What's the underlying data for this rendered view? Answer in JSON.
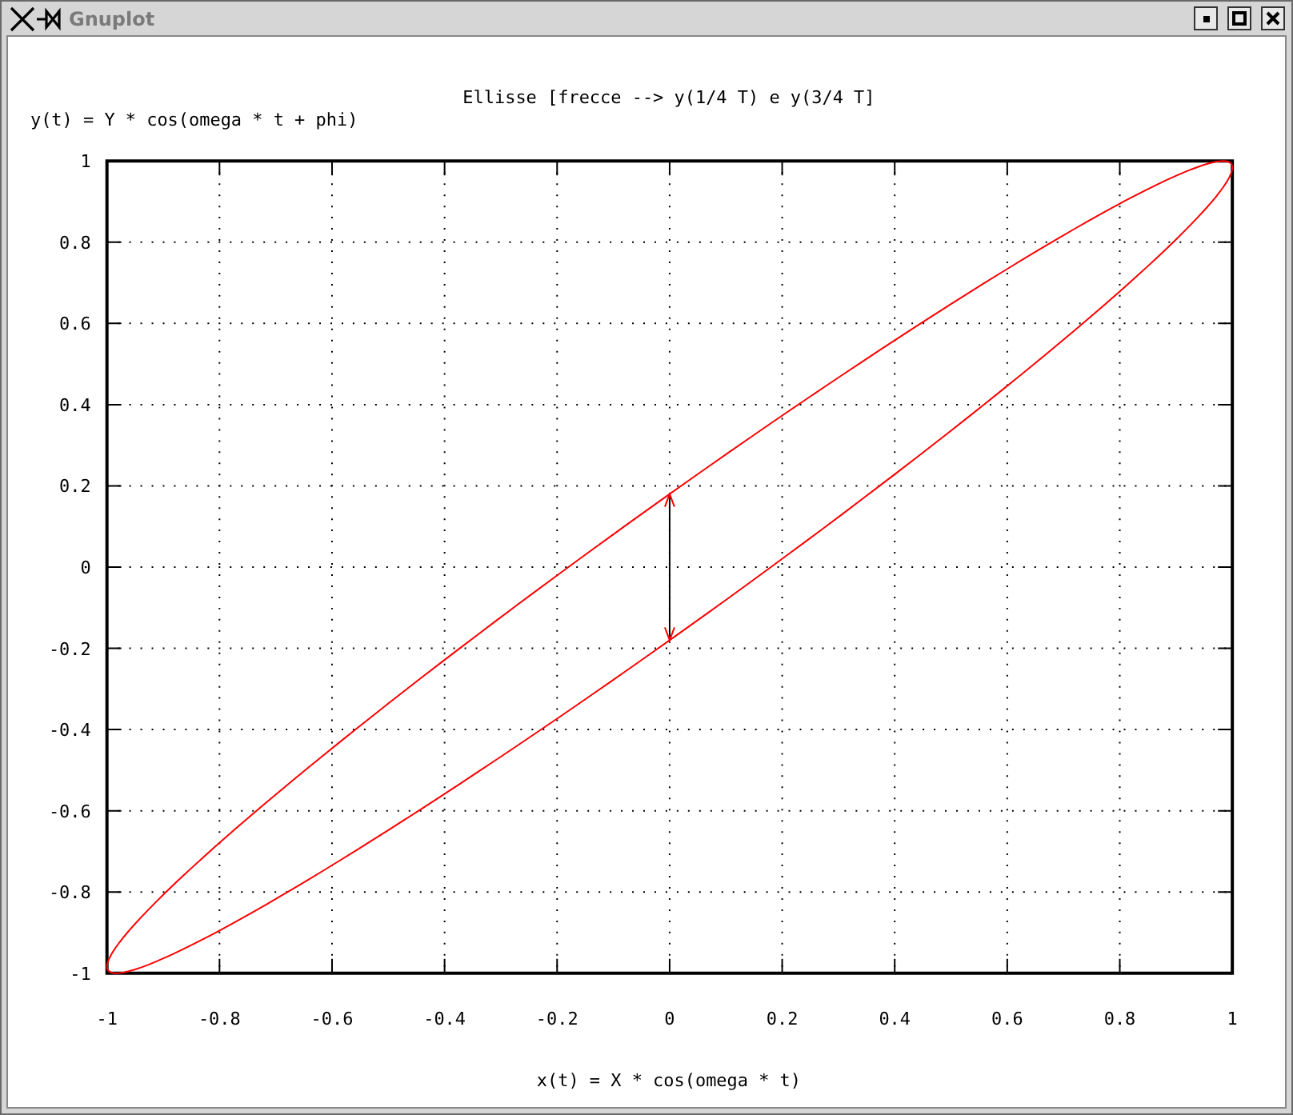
{
  "window": {
    "title": "Gnuplot"
  },
  "plot": {
    "chart_data": {
      "type": "line",
      "title": "Ellisse [frecce --> y(1/4 T) e y(3/4 T]",
      "xlabel": "x(t) = X * cos(omega *  t)",
      "ylabel": "y(t) = Y * cos(omega * t + phi)",
      "xlim": [
        -1,
        1
      ],
      "ylim": [
        -1,
        1
      ],
      "grid": true,
      "xticks": [
        -1,
        {
          "value": -0.8,
          "label": "-0.8"
        },
        {
          "value": -0.6,
          "label": "-0.6"
        },
        {
          "value": -0.4,
          "label": "-0.4"
        },
        {
          "value": -0.2,
          "label": "-0.2"
        },
        0,
        {
          "value": 0.2,
          "label": "0.2"
        },
        {
          "value": 0.4,
          "label": "0.4"
        },
        {
          "value": 0.6,
          "label": "0.6"
        },
        {
          "value": 0.8,
          "label": "0.8"
        },
        1
      ],
      "yticks": [
        -1,
        {
          "value": -0.8,
          "label": "-0.8"
        },
        {
          "value": -0.6,
          "label": "-0.6"
        },
        {
          "value": -0.4,
          "label": "-0.4"
        },
        {
          "value": -0.2,
          "label": "-0.2"
        },
        0,
        {
          "value": 0.2,
          "label": "0.2"
        },
        {
          "value": 0.4,
          "label": "0.4"
        },
        {
          "value": 0.6,
          "label": "0.6"
        },
        {
          "value": 0.8,
          "label": "0.8"
        },
        1
      ]
    }
  }
}
